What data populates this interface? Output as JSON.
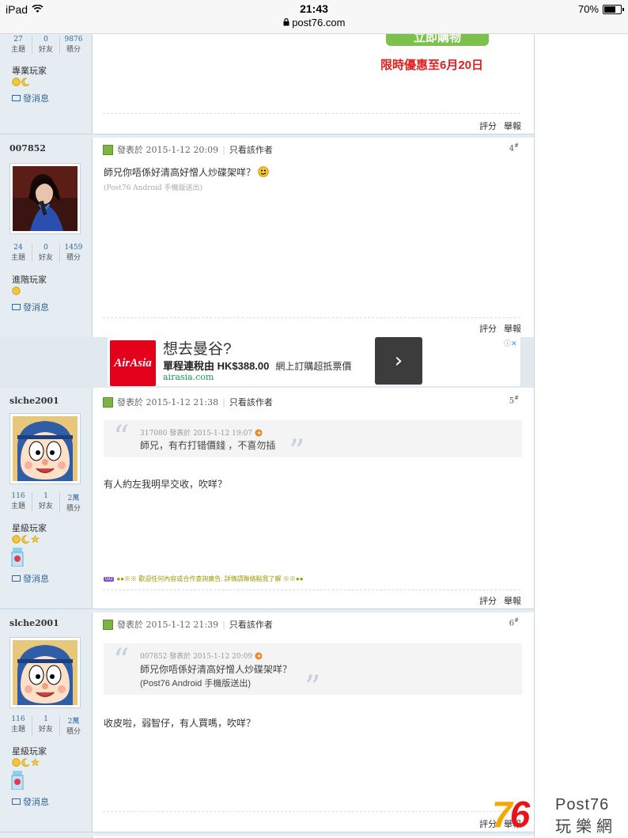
{
  "status_bar": {
    "device": "iPad",
    "time": "21:43",
    "url": "post76.com",
    "battery": "70%",
    "battery_level": 0.7
  },
  "promo": {
    "button": "立即購物",
    "text": "限時優惠至6月20日"
  },
  "labels": {
    "topics": "主題",
    "friends": "好友",
    "points": "積分",
    "send_message": "發消息",
    "only_author": "只看該作者",
    "rate": "評分",
    "report": "舉報"
  },
  "posts": [
    {
      "rank": "專業玩家",
      "topics": "27",
      "friends": "0",
      "points": "9876"
    },
    {
      "username": "007852",
      "topics": "24",
      "friends": "0",
      "points": "1459",
      "rank": "進階玩家",
      "posted": "發表於 2015-1-12 20:09",
      "floor": "4",
      "content": "師兄你唔係好清高好憎人炒碟架咩？",
      "signature": "(Post76 Android 手機版送出)"
    },
    {
      "username": "slche2001",
      "topics": "116",
      "friends": "1",
      "points": "2萬",
      "rank": "星級玩家",
      "posted": "發表於 2015-1-12 21:38",
      "floor": "5",
      "quote_head": "317080 發表於 2015-1-12 19:07",
      "quote_lines": [
        "師兄，有冇打错價錢 ，不喜勿插"
      ],
      "content": "有人約左我明早交收，吹咩？",
      "notice": "●●※※ 歡迎任何內容或合作查詢廣告, 詳情請聯絡點我了解 ※※●●"
    },
    {
      "username": "slche2001",
      "topics": "116",
      "friends": "1",
      "points": "2萬",
      "rank": "星級玩家",
      "posted": "發表於 2015-1-12 21:39",
      "floor": "6",
      "quote_head": "007852 發表於 2015-1-12 20:09",
      "quote_lines": [
        "師兄你唔係好清高好憎人炒碟架咩？",
        "(Post76 Android 手機版送出)"
      ],
      "content": "收皮啦，弱智仔，有人買嗎，吹咩？"
    }
  ],
  "ad": {
    "logo": "AirAsia",
    "title": "想去曼谷?",
    "line_bold": "單程連稅由 HK$388.00",
    "line_sub": "網上訂購超抵票價",
    "domain": "airasia.com"
  },
  "watermark": {
    "number": "76",
    "brand": "Post76",
    "name": "玩樂網"
  }
}
